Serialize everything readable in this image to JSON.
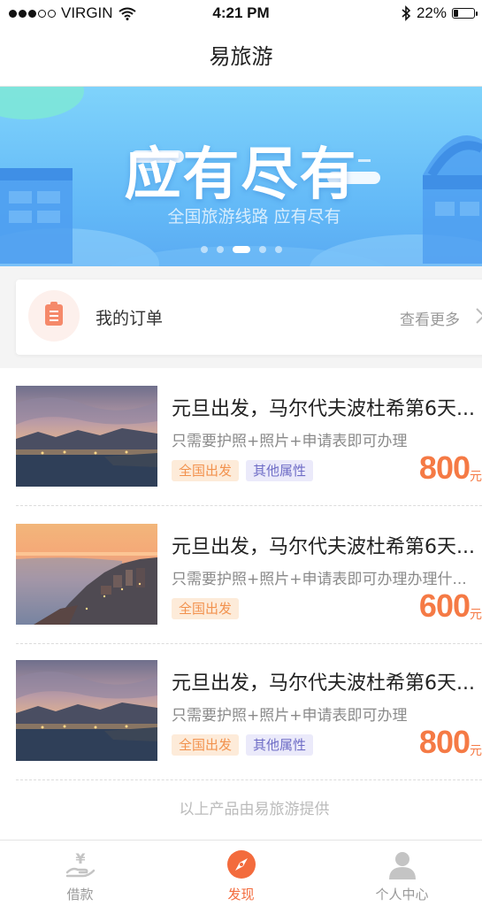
{
  "status_bar": {
    "carrier": "VIRGIN",
    "time": "4:21 PM",
    "battery": "22%",
    "battery_level": 0.22,
    "signal_bars_filled": 3,
    "signal_bars_total": 5
  },
  "nav": {
    "title": "易旅游"
  },
  "banner": {
    "title": "应有尽有",
    "subtitle": "全国旅游线路 应有尽有",
    "page_count": 5,
    "active_page": 2
  },
  "orders": {
    "label": "我的订单",
    "more": "查看更多",
    "icon": "clipboard-icon"
  },
  "products": [
    {
      "title": "元旦出发，马尔代夫波杜希第6天...",
      "description": "只需要护照+照片+申请表即可办理",
      "tags": [
        "全国出发",
        "其他属性"
      ],
      "price": "800",
      "unit": "元",
      "image": "dusk-harbor-city-photo"
    },
    {
      "title": "元旦出发，马尔代夫波杜希第6天...",
      "description": "只需要护照+照片+申请表即可办理办理什...",
      "tags": [
        "全国出发"
      ],
      "price": "600",
      "unit": "元",
      "image": "sunset-coastal-city-photo"
    },
    {
      "title": "元旦出发，马尔代夫波杜希第6天...",
      "description": "只需要护照+照片+申请表即可办理",
      "tags": [
        "全国出发",
        "其他属性"
      ],
      "price": "800",
      "unit": "元",
      "image": "dusk-harbor-city-photo"
    }
  ],
  "footer_note": "以上产品由易旅游提供",
  "tabs": [
    {
      "label": "借款",
      "icon": "yen-hand-icon",
      "active": false
    },
    {
      "label": "发现",
      "icon": "compass-icon",
      "active": true
    },
    {
      "label": "个人中心",
      "icon": "user-icon",
      "active": false
    }
  ],
  "colors": {
    "accent": "#f36b3d",
    "price": "#f57a45",
    "banner_top": "#7fd3fb",
    "banner_bottom": "#5aaaf2"
  }
}
